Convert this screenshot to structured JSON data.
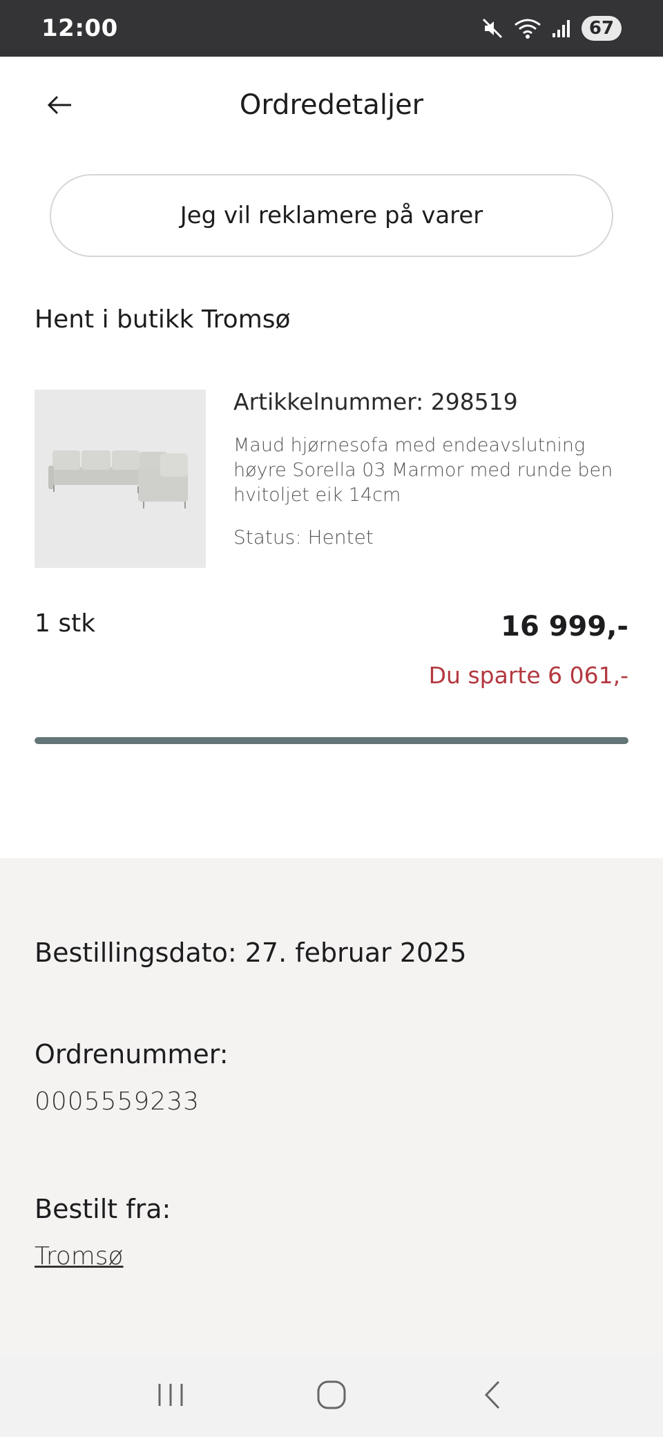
{
  "status_bar": {
    "time": "12:00",
    "battery": "67"
  },
  "header": {
    "title": "Ordredetaljer"
  },
  "actions": {
    "complaint_label": "Jeg vil reklamere på varer"
  },
  "pickup": {
    "title": "Hent i butikk Tromsø"
  },
  "product": {
    "article_number": "Artikkelnummer: 298519",
    "description": "Maud hjørnesofa med endeavslutning høyre Sorella 03 Marmor med runde ben hvitoljet eik 14cm",
    "status": "Status: Hentet",
    "quantity": "1 stk",
    "price": "16 999,-",
    "savings": "Du sparte 6 061,-"
  },
  "order_progress": {
    "fraction": 1.0
  },
  "order_info": {
    "date_label": "Bestillingsdato:",
    "date_value": "27. februar 2025",
    "number_label": "Ordrenummer:",
    "number_value": "0005559233",
    "from_label": "Bestilt fra:",
    "from_value": "Tromsø"
  },
  "colors": {
    "accent_red": "#b3383f",
    "progress": "#637576",
    "status_bar_bg": "#343436"
  },
  "icons": {
    "back": "arrow-left-icon",
    "mute": "mute-icon",
    "wifi": "wifi-icon",
    "signal": "signal-icon",
    "recent": "recent-apps-icon",
    "home": "home-icon",
    "nav_back": "nav-back-icon"
  }
}
